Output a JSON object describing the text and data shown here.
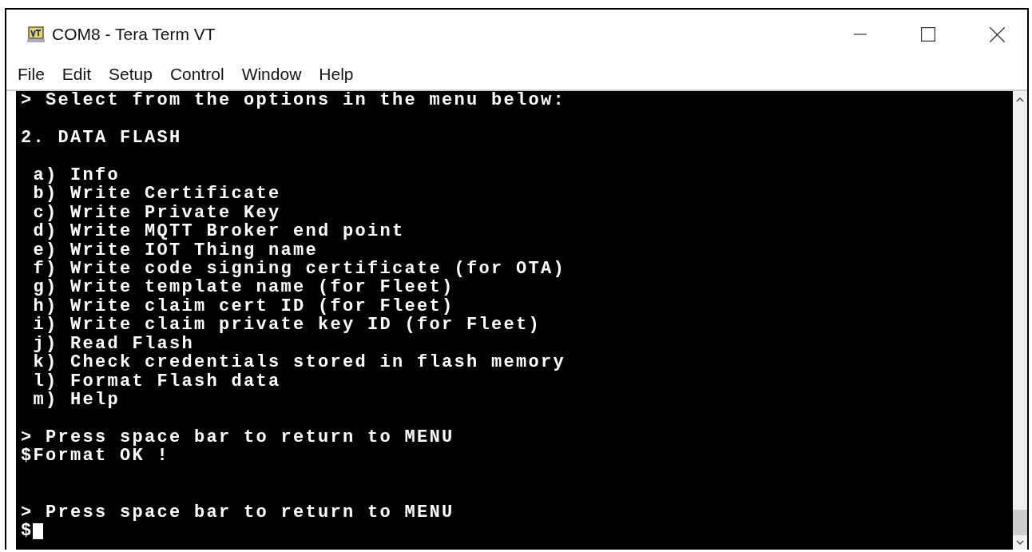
{
  "window": {
    "title": "COM8 - Tera Term VT"
  },
  "menu": [
    "File",
    "Edit",
    "Setup",
    "Control",
    "Window",
    "Help"
  ],
  "terminal": {
    "lines": [
      {
        "kind": "text",
        "text": "> Select from the options in the menu below:"
      },
      {
        "kind": "blank"
      },
      {
        "kind": "text",
        "text": "2. DATA FLASH"
      },
      {
        "kind": "blank"
      },
      {
        "kind": "text",
        "text": " a) Info"
      },
      {
        "kind": "text",
        "text": " b) Write Certificate"
      },
      {
        "kind": "text",
        "text": " c) Write Private Key"
      },
      {
        "kind": "text",
        "text": " d) Write MQTT Broker end point"
      },
      {
        "kind": "text",
        "text": " e) Write IOT Thing name"
      },
      {
        "kind": "text",
        "text": " f) Write code signing certificate (for OTA)"
      },
      {
        "kind": "text",
        "text": " g) Write template name (for Fleet)"
      },
      {
        "kind": "text",
        "text": " h) Write claim cert ID (for Fleet)"
      },
      {
        "kind": "text",
        "text": " i) Write claim private key ID (for Fleet)"
      },
      {
        "kind": "text",
        "text": " j) Read Flash"
      },
      {
        "kind": "text",
        "text": " k) Check credentials stored in flash memory"
      },
      {
        "kind": "text",
        "text": " l) Format Flash data"
      },
      {
        "kind": "text",
        "text": " m) Help"
      },
      {
        "kind": "blank"
      },
      {
        "kind": "text",
        "text": "> Press space bar to return to MENU"
      },
      {
        "kind": "text",
        "text": "$Format OK !"
      },
      {
        "kind": "blank"
      },
      {
        "kind": "blank"
      },
      {
        "kind": "text",
        "text": "> Press space bar to return to MENU"
      },
      {
        "kind": "text",
        "text": "$",
        "cursor": true
      }
    ]
  }
}
